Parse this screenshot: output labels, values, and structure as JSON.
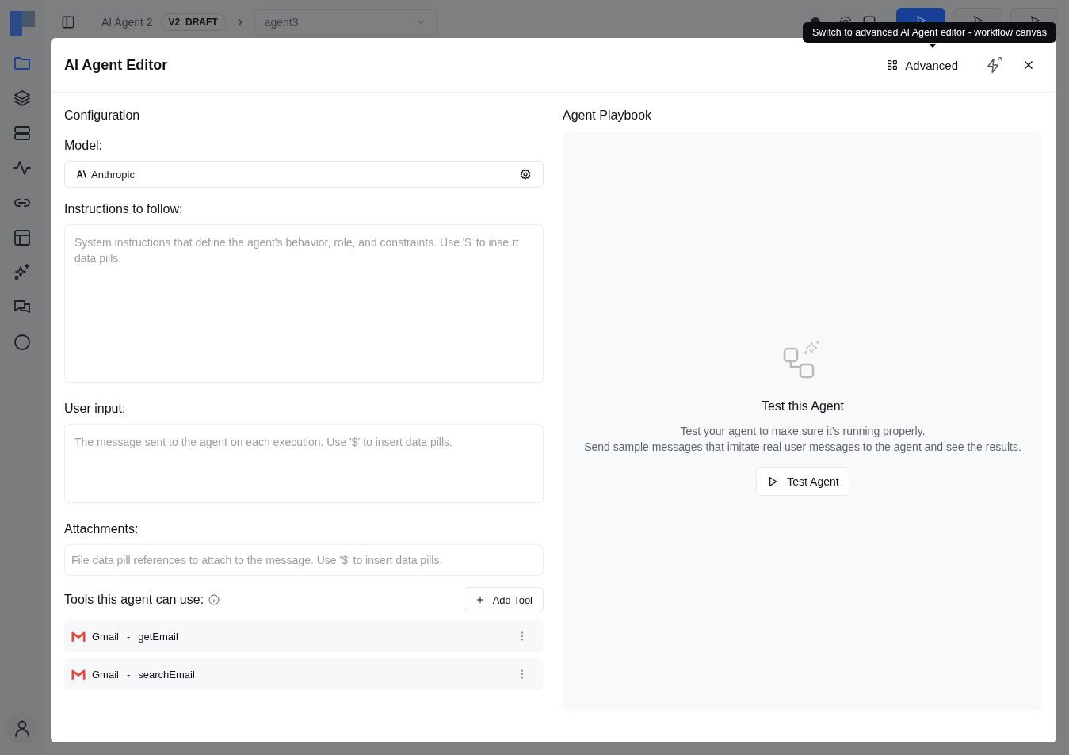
{
  "sidebar": {
    "items": [
      {
        "kind": "folder",
        "selected": true
      },
      {
        "kind": "layers",
        "selected": false
      },
      {
        "kind": "server",
        "selected": false
      },
      {
        "kind": "activity",
        "selected": false
      },
      {
        "kind": "link",
        "selected": false
      },
      {
        "kind": "table",
        "selected": false
      },
      {
        "kind": "sparkles",
        "selected": false
      },
      {
        "kind": "chat",
        "selected": false
      },
      {
        "kind": "circle",
        "selected": false
      }
    ]
  },
  "topbar": {
    "breadcrumb": "AI Agent 2",
    "version": "V2",
    "status": "DRAFT",
    "agent_select": "agent3",
    "buttons": [
      {
        "kind": "primary"
      },
      {
        "kind": "secondary"
      },
      {
        "kind": "secondary"
      }
    ]
  },
  "tooltip": "Switch to advanced AI Agent editor - workflow canvas",
  "dialog": {
    "title": "AI Agent Editor",
    "advanced_button": "Advanced",
    "configuration": {
      "heading": "Configuration",
      "model_label": "Model:",
      "model": "Anthropic",
      "instructions_label": "Instructions to follow:",
      "instructions_placeholder": "System instructions that define the agent's behavior, role, and constraints. Use '$' to inse rt data pills.",
      "user_input_label": "User input:",
      "user_input_placeholder": "The message sent to the agent on each execution. Use '$' to insert data pills.",
      "attachments_label": "Attachments:",
      "attachments_placeholder": "File data pill references to attach to the message. Use '$' to insert data pills.",
      "tools_label": "Tools this agent can use:",
      "add_tool_button": "Add Tool",
      "tools": [
        {
          "app": "Gmail",
          "separator": "-",
          "action": "getEmail"
        },
        {
          "app": "Gmail",
          "separator": "-",
          "action": "searchEmail"
        }
      ]
    },
    "playbook": {
      "heading": "Agent Playbook",
      "empty_title": "Test this Agent",
      "empty_text": "Test your agent to make sure it's running properly.",
      "empty_text_2": "Send sample messages that imitate real user messages to the agent and see the results.",
      "test_button": "Test Agent"
    }
  }
}
